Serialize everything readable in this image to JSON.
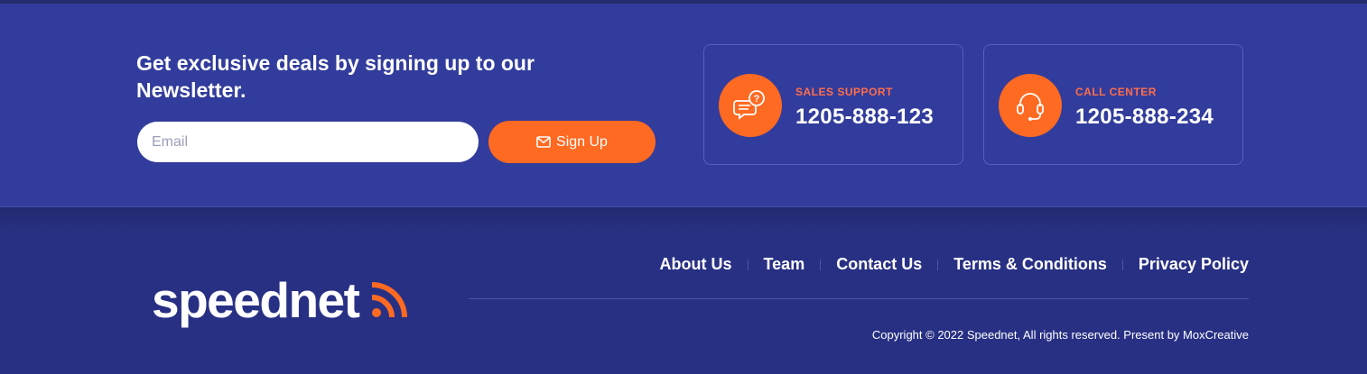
{
  "newsletter": {
    "title": "Get exclusive deals by signing up to our Newsletter.",
    "email_placeholder": "Email",
    "signup_label": "Sign Up"
  },
  "contacts": [
    {
      "label": "SALES SUPPORT",
      "phone": "1205-888-123",
      "icon": "chat-question-icon"
    },
    {
      "label": "CALL CENTER",
      "phone": "1205-888-234",
      "icon": "headset-icon"
    }
  ],
  "footer": {
    "logo_text": "speednet",
    "nav": [
      "About Us",
      "Team",
      "Contact Us",
      "Terms & Conditions",
      "Privacy Policy"
    ],
    "copyright": "Copyright © 2022 Speednet, All rights reserved. Present by MoxCreative"
  },
  "colors": {
    "accent": "#ff6a22",
    "newsletter_bg": "#323c9c",
    "footer_bg": "#283084",
    "label_color": "#ff6e4a"
  }
}
